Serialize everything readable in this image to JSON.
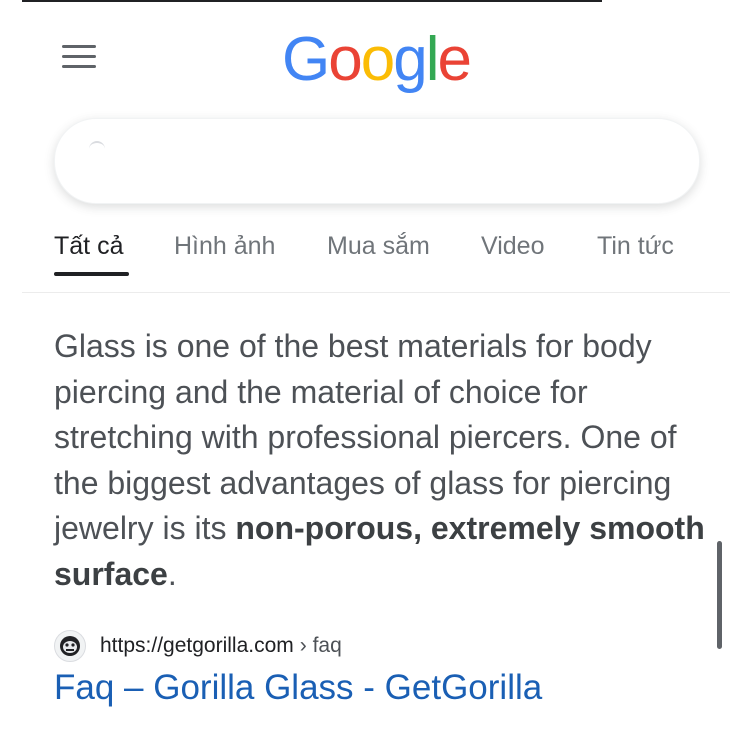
{
  "header": {
    "logo": {
      "letters": [
        "G",
        "o",
        "o",
        "g",
        "l",
        "e"
      ],
      "colors": [
        "#4285F4",
        "#EA4335",
        "#FBBC05",
        "#4285F4",
        "#34A853",
        "#EA4335"
      ]
    },
    "menu_icon": "hamburger-menu-icon"
  },
  "search": {
    "value": ""
  },
  "tabs": [
    {
      "label": "Tất cả",
      "active": true
    },
    {
      "label": "Hình ảnh",
      "active": false
    },
    {
      "label": "Mua sắm",
      "active": false
    },
    {
      "label": "Video",
      "active": false
    },
    {
      "label": "Tin tức",
      "active": false
    }
  ],
  "snippet": {
    "text_before": "Glass is one of the best materials for body piercing and the material of choice for stretching with professional piercers. One of the biggest advantages of glass for piercing jewelry is its ",
    "text_bold": "non-porous, extremely smooth surface",
    "text_after": "."
  },
  "result": {
    "url": "https://getgorilla.com",
    "breadcrumb": "› faq",
    "title": "Faq – Gorilla Glass - GetGorilla",
    "favicon": "gorilla-favicon-icon"
  },
  "colors": {
    "link": "#1a5fb4",
    "snippet_text": "#4d5156",
    "tab_text": "#70757a",
    "active_tab": "#202124"
  }
}
